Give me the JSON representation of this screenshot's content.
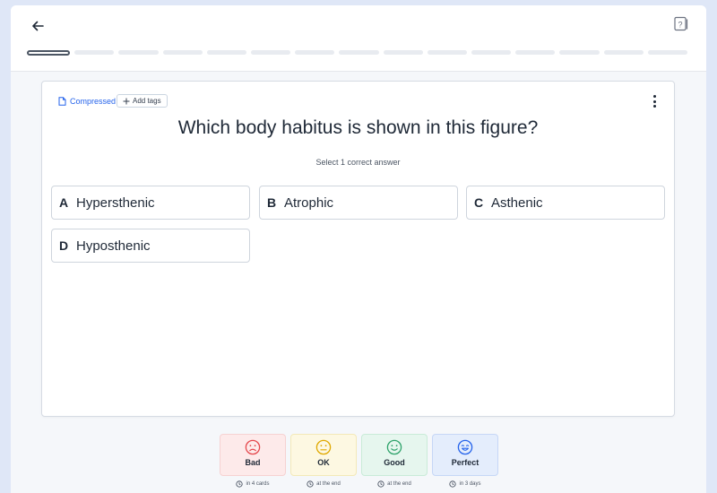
{
  "deck": {
    "name": "Compressed",
    "add_tags_label": "Add tags",
    "icon": "document-icon"
  },
  "question": {
    "text": "Which body habitus is shown in this figure?",
    "instruction": "Select 1 correct answer"
  },
  "options": [
    {
      "letter": "A",
      "text": "Hypersthenic"
    },
    {
      "letter": "B",
      "text": "Atrophic"
    },
    {
      "letter": "C",
      "text": "Asthenic"
    },
    {
      "letter": "D",
      "text": "Hyposthenic"
    }
  ],
  "progress": {
    "total_segments": 15,
    "current_index": 0
  },
  "ratings": [
    {
      "label": "Bad",
      "when": "in 4 cards",
      "color": "#e5484d",
      "icon": "frown-face-icon"
    },
    {
      "label": "OK",
      "when": "at the end",
      "color": "#e0a800",
      "icon": "neutral-face-icon"
    },
    {
      "label": "Good",
      "when": "at the end",
      "color": "#2fa36b",
      "icon": "smile-face-icon"
    },
    {
      "label": "Perfect",
      "when": "in 3 days",
      "color": "#2563eb",
      "icon": "grin-face-icon"
    }
  ],
  "colors": {
    "accent": "#2563eb",
    "card_border": "#d6dbe3",
    "page_bg": "#f5f7fa"
  }
}
